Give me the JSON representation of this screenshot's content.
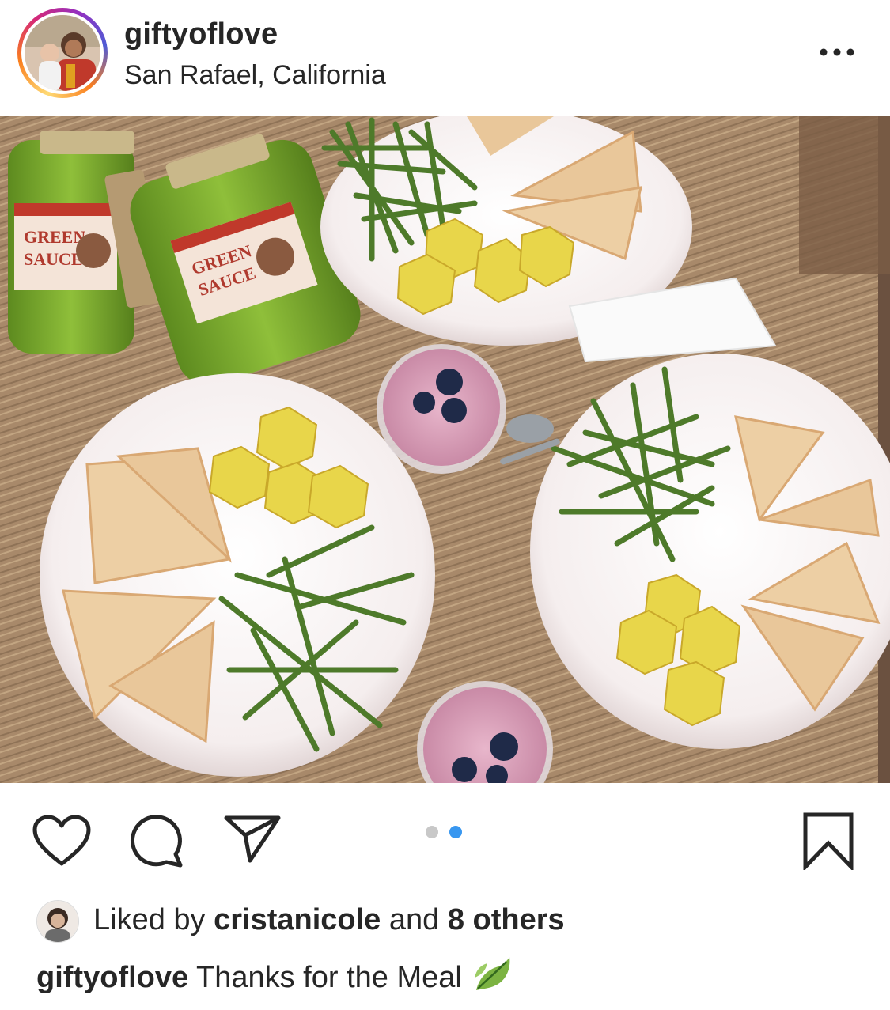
{
  "post": {
    "username": "giftyoflove",
    "location": "San Rafael, California"
  },
  "header": {
    "more_icon": "more-horizontal-icon"
  },
  "photo": {
    "jar_label_line1": "GREEN",
    "jar_label_line2": "SAUCE"
  },
  "actions": {
    "like_icon": "heart-icon",
    "comment_icon": "comment-icon",
    "share_icon": "send-icon",
    "save_icon": "bookmark-icon",
    "carousel_total": 2,
    "carousel_active": 2,
    "dot_active_color": "#3897f0",
    "dot_inactive_color": "#c8c8c8"
  },
  "likes": {
    "prefix": "Liked by ",
    "user": "cristanicole",
    "middle": " and ",
    "others": "8 others"
  },
  "caption": {
    "username": "giftyoflove",
    "text": " Thanks for the Meal",
    "emoji_icon": "leaf-icon"
  }
}
